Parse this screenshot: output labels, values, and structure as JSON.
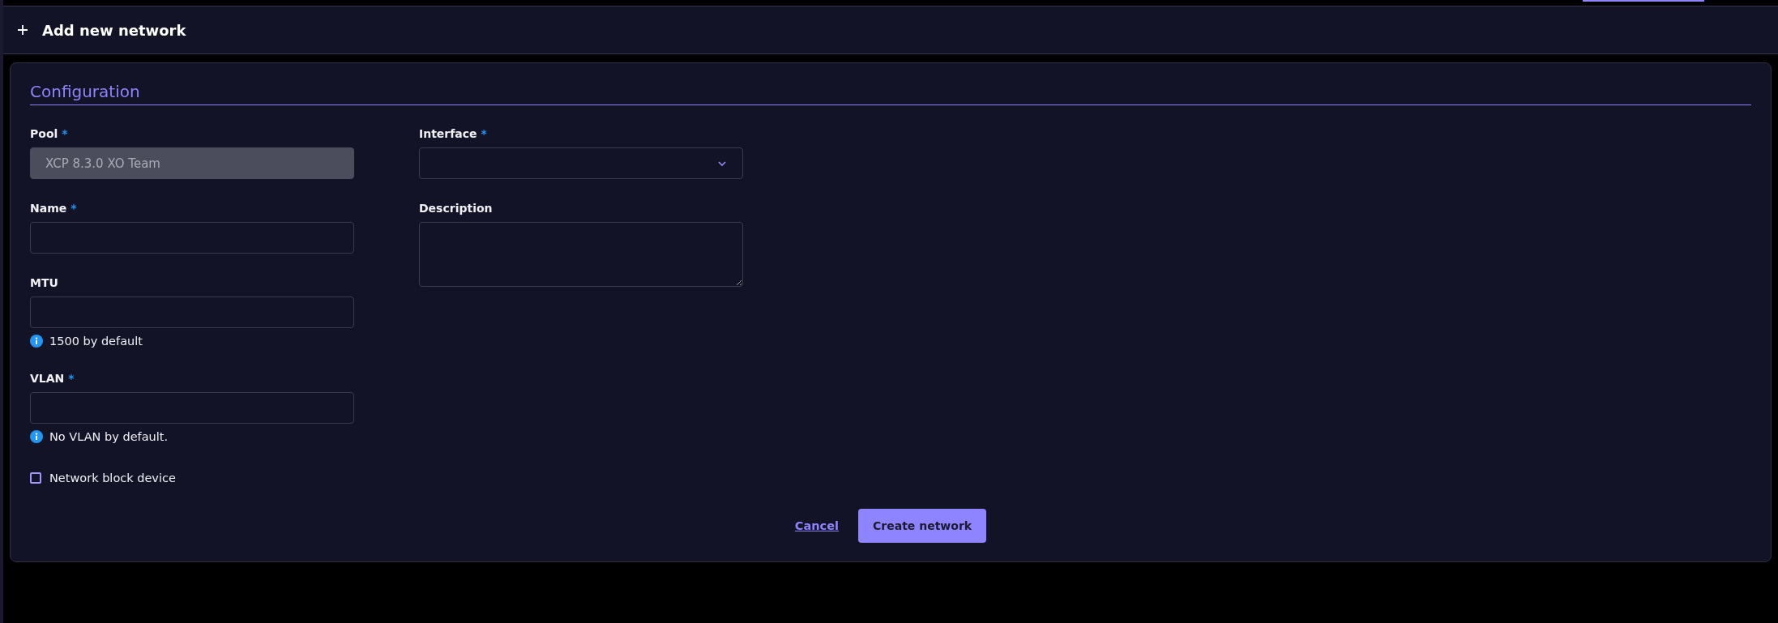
{
  "header": {
    "title": "Add new network"
  },
  "section": {
    "title": "Configuration"
  },
  "columns": [
    {
      "fields": [
        {
          "kind": "text",
          "label": "Pool",
          "required_mark": "*",
          "value": "XCP 8.3.0 XO Team",
          "disabled": true
        },
        {
          "kind": "text",
          "label": "Name",
          "required_mark": "*",
          "disabled": false
        },
        {
          "kind": "text",
          "label": "MTU",
          "disabled": false,
          "help": "1500 by default"
        },
        {
          "kind": "text",
          "label": "VLAN",
          "required_mark": "*",
          "disabled": false,
          "help": "No VLAN by default."
        },
        {
          "kind": "checkbox",
          "label": "Network block device",
          "checked": false,
          "disabled": false
        }
      ]
    },
    {
      "fields": [
        {
          "kind": "select",
          "label": "Interface",
          "required_mark": "*",
          "disabled": false
        },
        {
          "kind": "textarea",
          "label": "Description",
          "disabled": false
        }
      ]
    }
  ],
  "actions": [
    {
      "kind": "link",
      "label": "Cancel"
    },
    {
      "kind": "primary",
      "label": "Create network"
    }
  ]
}
